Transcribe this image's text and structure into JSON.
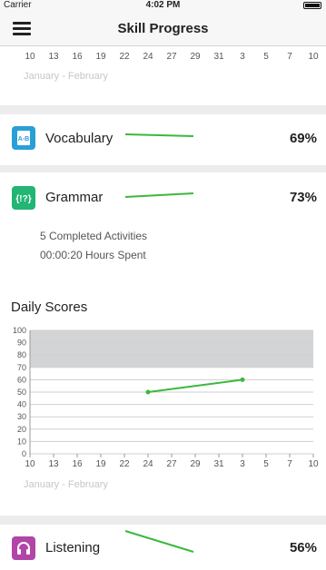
{
  "status": {
    "carrier": "Carrier",
    "time": "4:02 PM"
  },
  "nav": {
    "title": "Skill Progress"
  },
  "top_chart": {
    "x_ticks": [
      "10",
      "13",
      "16",
      "19",
      "22",
      "24",
      "27",
      "29",
      "31",
      "3",
      "5",
      "7",
      "10"
    ],
    "month_range": "January - February"
  },
  "skills": [
    {
      "name": "Vocabulary",
      "percent": "69%",
      "icon": "book-icon",
      "color": "#2a9fd6"
    },
    {
      "name": "Grammar",
      "percent": "73%",
      "icon": "grammar-icon",
      "color": "#22b573"
    },
    {
      "name": "Listening",
      "percent": "56%",
      "icon": "headphones-icon",
      "color": "#b245a8"
    }
  ],
  "grammar_details": {
    "completed": "5 Completed Activities",
    "hours": "00:00:20 Hours Spent"
  },
  "daily_scores": {
    "title": "Daily Scores",
    "month_range": "January - February"
  },
  "chart_data": {
    "type": "line",
    "title": "Daily Scores",
    "xlabel": "January - February",
    "ylabel": "",
    "x": [
      "10",
      "13",
      "16",
      "19",
      "22",
      "24",
      "27",
      "29",
      "31",
      "3",
      "5",
      "7",
      "10"
    ],
    "y_ticks": [
      "0",
      "10",
      "20",
      "30",
      "40",
      "50",
      "60",
      "70",
      "80",
      "90",
      "100"
    ],
    "ylim": [
      0,
      100
    ],
    "shaded_band": [
      70,
      100
    ],
    "series": [
      {
        "color": "#3cb83c",
        "points": [
          {
            "x": "24",
            "y": 50
          },
          {
            "x": "3",
            "y": 60
          }
        ]
      }
    ],
    "grid": true
  },
  "colors": {
    "accent_line": "#3cb83c",
    "band": "#d3d4d6"
  }
}
